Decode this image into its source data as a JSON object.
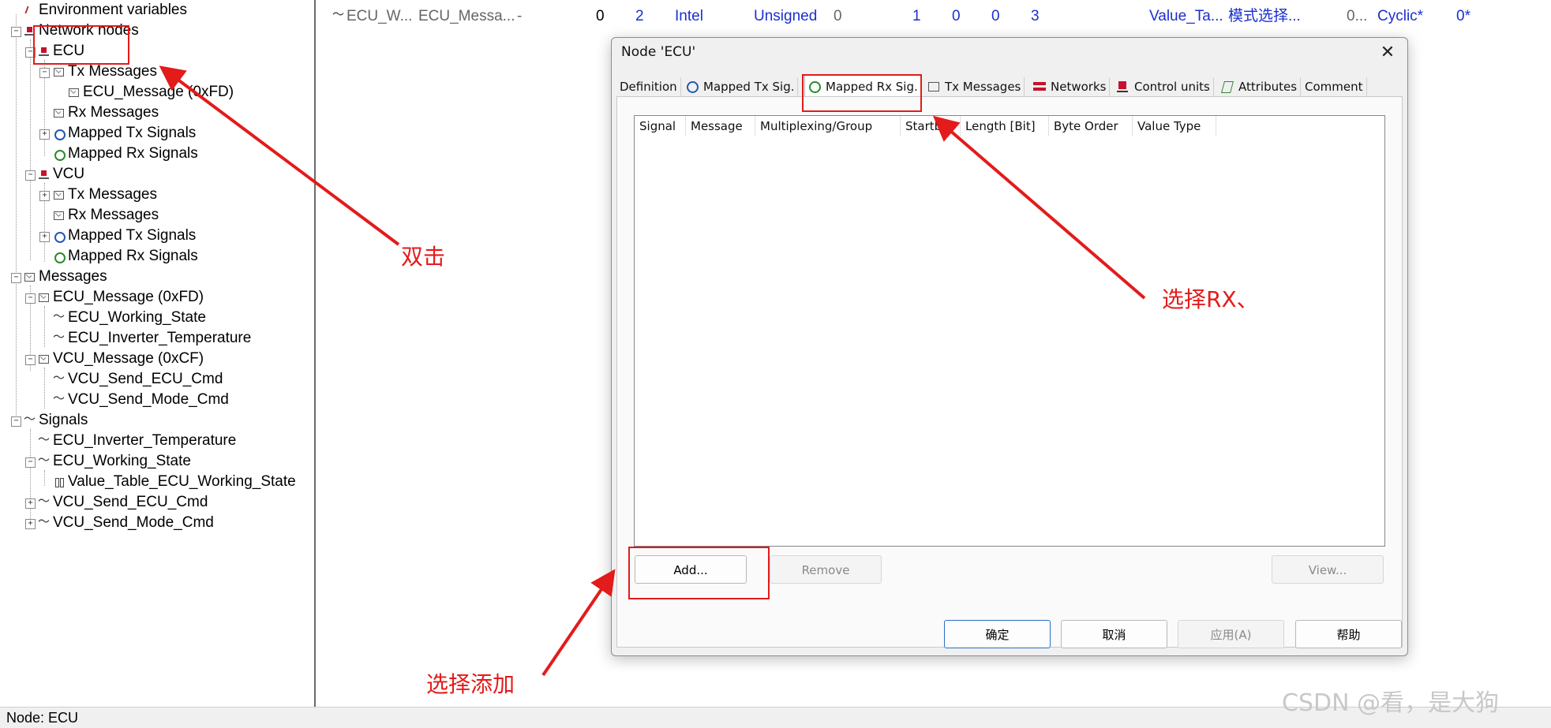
{
  "tree": {
    "items": [
      {
        "label": "Environment variables",
        "icon": "environment-icon",
        "expander": ""
      },
      {
        "label": "Network nodes",
        "icon": "node-icon",
        "expander": "−"
      },
      {
        "label": "ECU",
        "icon": "node-icon",
        "expander": "−"
      },
      {
        "label": "Tx Messages",
        "icon": "message-icon",
        "expander": "−"
      },
      {
        "label": "ECU_Message (0xFD)",
        "icon": "message-icon",
        "expander": ""
      },
      {
        "label": "Rx Messages",
        "icon": "message-icon",
        "expander": ""
      },
      {
        "label": "Mapped Tx Signals",
        "icon": "mapped-tx-icon",
        "expander": "+"
      },
      {
        "label": "Mapped Rx Signals",
        "icon": "mapped-rx-icon",
        "expander": ""
      },
      {
        "label": "VCU",
        "icon": "node-icon",
        "expander": "−"
      },
      {
        "label": "Tx Messages",
        "icon": "message-icon",
        "expander": "+"
      },
      {
        "label": "Rx Messages",
        "icon": "message-icon",
        "expander": ""
      },
      {
        "label": "Mapped Tx Signals",
        "icon": "mapped-tx-icon",
        "expander": "+"
      },
      {
        "label": "Mapped Rx Signals",
        "icon": "mapped-rx-icon",
        "expander": ""
      },
      {
        "label": "Messages",
        "icon": "message-icon",
        "expander": "−"
      },
      {
        "label": "ECU_Message (0xFD)",
        "icon": "message-icon",
        "expander": "−"
      },
      {
        "label": "ECU_Working_State",
        "icon": "signal-icon",
        "expander": ""
      },
      {
        "label": "ECU_Inverter_Temperature",
        "icon": "signal-icon",
        "expander": ""
      },
      {
        "label": "VCU_Message (0xCF)",
        "icon": "message-icon",
        "expander": "−"
      },
      {
        "label": "VCU_Send_ECU_Cmd",
        "icon": "signal-icon",
        "expander": ""
      },
      {
        "label": "VCU_Send_Mode_Cmd",
        "icon": "signal-icon",
        "expander": ""
      },
      {
        "label": "Signals",
        "icon": "signal-icon",
        "expander": "−"
      },
      {
        "label": "ECU_Inverter_Temperature",
        "icon": "signal-icon",
        "expander": ""
      },
      {
        "label": "ECU_Working_State",
        "icon": "signal-icon",
        "expander": "−"
      },
      {
        "label": "Value_Table_ECU_Working_State",
        "icon": "value-table-icon",
        "expander": ""
      },
      {
        "label": "VCU_Send_ECU_Cmd",
        "icon": "signal-icon",
        "expander": "+"
      },
      {
        "label": "VCU_Send_Mode_Cmd",
        "icon": "signal-icon",
        "expander": "+"
      }
    ]
  },
  "grid": {
    "row": [
      "ECU_W...",
      "ECU_Messa...",
      "-",
      "0",
      "2",
      "Intel",
      "Unsigned",
      "0",
      "1",
      "0",
      "0",
      "3",
      "Value_Ta...",
      "模式选择...",
      "0...",
      "Cyclic*",
      "0*"
    ]
  },
  "statusbar": {
    "text": "Node: ECU"
  },
  "dialog": {
    "title": "Node 'ECU'",
    "close_glyph": "✕",
    "tabs": [
      {
        "label": "Definition",
        "icon": ""
      },
      {
        "label": "Mapped Tx Sig.",
        "icon": "mapped-tx-icon"
      },
      {
        "label": "Mapped Rx Sig.",
        "icon": "mapped-rx-icon"
      },
      {
        "label": "Tx Messages",
        "icon": "message-icon"
      },
      {
        "label": "Networks",
        "icon": "network-icon"
      },
      {
        "label": "Control units",
        "icon": "control-unit-icon"
      },
      {
        "label": "Attributes",
        "icon": "attributes-icon"
      },
      {
        "label": "Comment",
        "icon": ""
      }
    ],
    "active_tab": "Mapped Rx Sig.",
    "columns": [
      "Signal",
      "Message",
      "Multiplexing/Group",
      "Startbit",
      "Length [Bit]",
      "Byte Order",
      "Value Type"
    ],
    "buttons": {
      "add": "Add...",
      "remove": "Remove",
      "view": "View..."
    },
    "footer": {
      "ok": "确定",
      "cancel": "取消",
      "apply": "应用(A)",
      "help": "帮助"
    }
  },
  "annotations": {
    "double_click": "双击",
    "select_rx": "选择RX、",
    "select_add": "选择添加"
  },
  "watermark": "CSDN @看，是大狗",
  "colors": {
    "annotation": "#e31b1b",
    "grid_blue": "#1a2fd0",
    "dialog_bg": "#f0f0f0"
  }
}
